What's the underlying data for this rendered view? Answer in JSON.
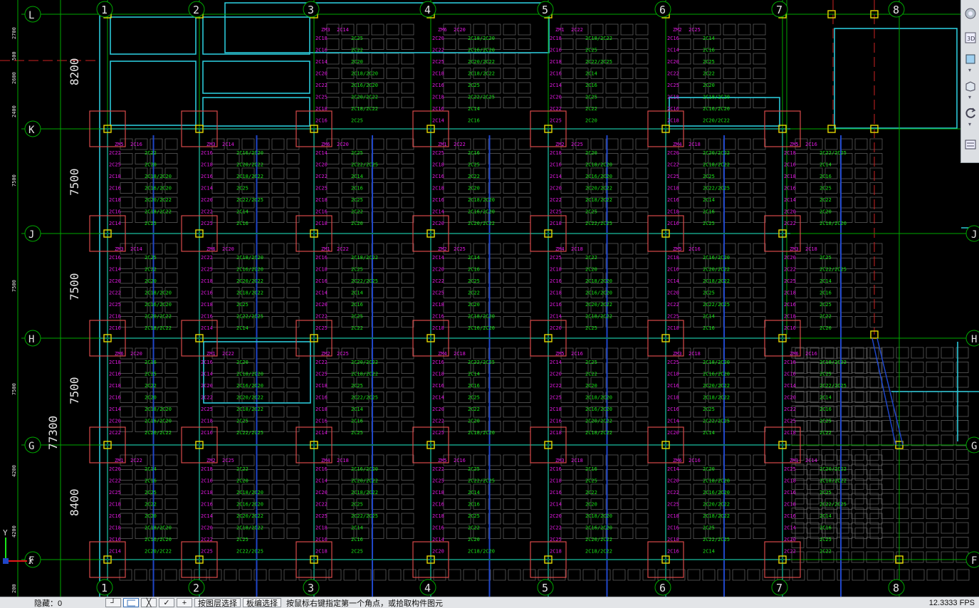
{
  "grid": {
    "columns": [
      "1",
      "2",
      "3",
      "4",
      "5",
      "6",
      "7",
      "8"
    ],
    "rows_top_to_bottom": [
      "L",
      "K",
      "J",
      "H",
      "G",
      "F"
    ],
    "total_dimension": "77300",
    "row_spans": [
      "8200",
      "7500",
      "7500",
      "7500",
      "8400"
    ],
    "sub_dimensions": [
      "2700",
      "500",
      "2600",
      "2400",
      "7500",
      "7500",
      "7500",
      "4200",
      "4200",
      "200"
    ]
  },
  "annotations": {
    "mark_pool": [
      "ZM4",
      "ZM5",
      "ZM3",
      "ZM6",
      "ZM1",
      "ZM2"
    ],
    "bar_pool_left": [
      "2C18",
      "2C16",
      "2C14",
      "2C20",
      "2C22",
      "2C25",
      "2C18",
      "2C16"
    ],
    "bar_pool_center": [
      "2C25",
      "2C22",
      "2C20",
      "2C18/2C20",
      "2C16/2C20",
      "2C20/2C22",
      "2C18/2C22",
      "2C25",
      "2C22/2C25",
      "2C14",
      "2C16"
    ]
  },
  "ucs": {
    "x_label": "X",
    "y_label": "Y"
  },
  "toolstrip": {
    "items": [
      {
        "name": "navigation-wheel",
        "label": ""
      },
      {
        "name": "view-3d",
        "label": "3D"
      },
      {
        "name": "visual-style",
        "label": ""
      },
      {
        "name": "view-box",
        "label": ""
      },
      {
        "name": "orbit",
        "label": ""
      },
      {
        "name": "layer-panel",
        "label": ""
      }
    ]
  },
  "statusbar": {
    "left_label": "隐藏：0",
    "buttons": [
      "按图层选择",
      "板编选择"
    ],
    "prompt": "按鼠标右键指定第一个角点，或拾取构件图元",
    "right_value": "12.3333 FPS"
  },
  "colors": {
    "background": "#000000",
    "axis_line": "#00a800",
    "beam_cyan": "#2bc7d8",
    "beam_blue": "#1f46c8",
    "slab_grey": "#7a7a7a",
    "column_yellow": "#e8d800",
    "bar_green": "#19e619",
    "bar_magenta": "#e619e6",
    "cap_red": "#d94a4a"
  }
}
